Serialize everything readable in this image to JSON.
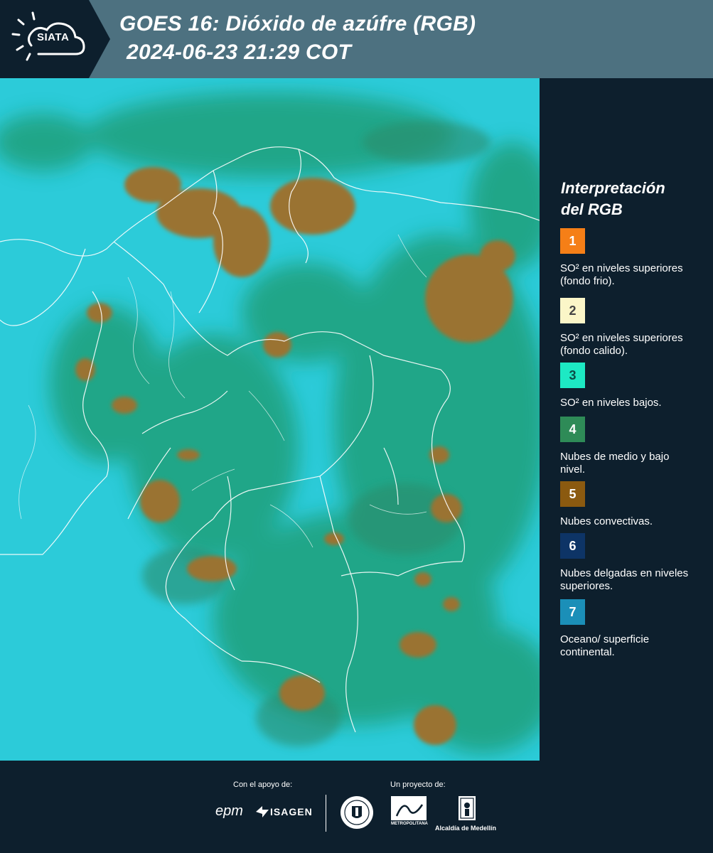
{
  "header": {
    "logo_text": "SIATA",
    "title_line1": "GOES 16: Dióxido de azúfre (RGB)",
    "title_line2": "2024-06-23 21:29 COT"
  },
  "legend": {
    "title_line1": "Interpretación",
    "title_line2": "del RGB",
    "items": [
      {
        "number": "1",
        "color": "#f57f17",
        "text_color": "#ffffff",
        "label": "SO² en niveles superiores (fondo frio)."
      },
      {
        "number": "2",
        "color": "#fbf6c8",
        "text_color": "#444444",
        "label": "SO² en niveles superiores (fondo calido)."
      },
      {
        "number": "3",
        "color": "#1de9c4",
        "text_color": "#0d4d47",
        "label": "SO² en niveles bajos."
      },
      {
        "number": "4",
        "color": "#2e8b57",
        "text_color": "#ffffff",
        "label": "Nubes de medio y bajo nivel."
      },
      {
        "number": "5",
        "color": "#8b5a10",
        "text_color": "#ffffff",
        "label": "Nubes convectivas."
      },
      {
        "number": "6",
        "color": "#0d3466",
        "text_color": "#ffffff",
        "label": "Nubes delgadas en niveles superiores."
      },
      {
        "number": "7",
        "color": "#1b8fb8",
        "text_color": "#ffffff",
        "label": "Oceano/ superficie continental."
      }
    ]
  },
  "footer": {
    "support_label": "Con el apoyo de:",
    "project_label": "Un proyecto de:",
    "sponsor_epm": "epm",
    "sponsor_isagen": "ISAGEN",
    "area_caption": "METROPOLITANA",
    "alcaldia_caption": "Alcaldía de Medellín"
  }
}
